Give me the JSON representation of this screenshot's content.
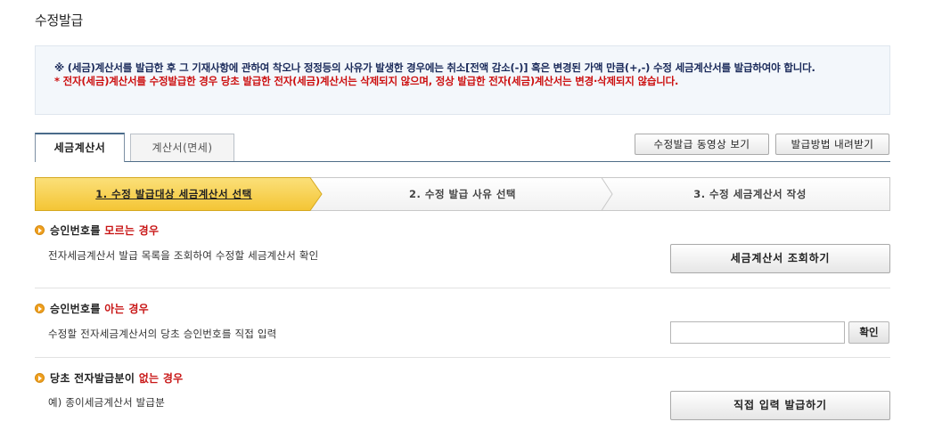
{
  "page": {
    "title": "수정발급"
  },
  "notice": {
    "line1": "※ (세금)계산서를 발급한 후 그 기재사항에 관하여 착오나 정정등의 사유가 발생한 경우에는 취소[전액 감소(-)] 혹은 변경된 가액 만큼(+,-) 수정 세금계산서를 발급하여야 합니다.",
    "line2": "* 전자(세금)계산서를 수정발급한 경우 당초 발급한 전자(세금)계산서는 삭제되지 않으며, 정상 발급한 전자(세금)계산서는 변경·삭제되지 않습니다."
  },
  "tabs": [
    {
      "label": "세금계산서",
      "active": true
    },
    {
      "label": "계산서(면세)",
      "active": false
    }
  ],
  "toolbar": {
    "video_label": "수정발급 동영상 보기",
    "download_label": "발급방법 내려받기"
  },
  "steps": [
    {
      "label": "1. 수정 발급대상 세금계산서 선택",
      "active": true
    },
    {
      "label": "2. 수정 발급 사유 선택",
      "active": false
    },
    {
      "label": "3. 수정 세금계산서 작성",
      "active": false
    }
  ],
  "sections": {
    "unknown": {
      "title_prefix": "승인번호를 ",
      "title_highlight": "모르는 경우",
      "description": "전자세금계산서 발급 목록을 조회하여 수정할 세금계산서 확인",
      "button_label": "세금계산서 조회하기"
    },
    "known": {
      "title_prefix": "승인번호를 ",
      "title_highlight": "아는 경우",
      "description": "수정할 전자세금계산서의 당초 승인번호를 직접 입력",
      "input_value": "",
      "button_label": "확인"
    },
    "not_electronic": {
      "title_prefix": "당초 전자발급분이 ",
      "title_highlight": "없는 경우",
      "description": "예) 종이세금계산서 발급분",
      "button_label": "직접 입력 발급하기"
    }
  },
  "colors": {
    "active_step": "#f9d24d",
    "highlight_red": "#c81515",
    "bullet": "#f0a020",
    "notice_bg": "#f3f7fb"
  }
}
